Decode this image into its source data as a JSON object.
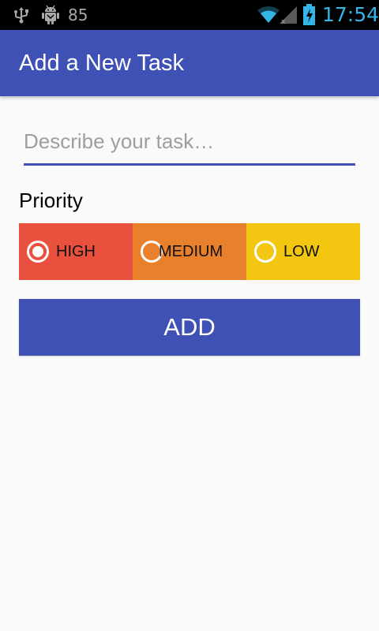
{
  "status_bar": {
    "battery_level": "85",
    "clock": "17:54",
    "icons": [
      "usb-icon",
      "android-debug-icon",
      "wifi-icon",
      "signal-icon",
      "battery-charging-icon"
    ]
  },
  "app_bar": {
    "title": "Add a New Task"
  },
  "task_input": {
    "placeholder": "Describe your task…",
    "value": ""
  },
  "priority": {
    "label": "Priority",
    "selected": "HIGH",
    "options": [
      {
        "label": "HIGH",
        "color": "#e9503e",
        "selected": true
      },
      {
        "label": "MEDIUM",
        "color": "#e8802c",
        "selected": false
      },
      {
        "label": "LOW",
        "color": "#f2c611",
        "selected": false
      }
    ]
  },
  "add_button": {
    "label": "ADD"
  },
  "colors": {
    "primary": "#3f51b5",
    "background": "#fafafa",
    "status_bar": "#000000",
    "clock": "#33b5e5"
  }
}
